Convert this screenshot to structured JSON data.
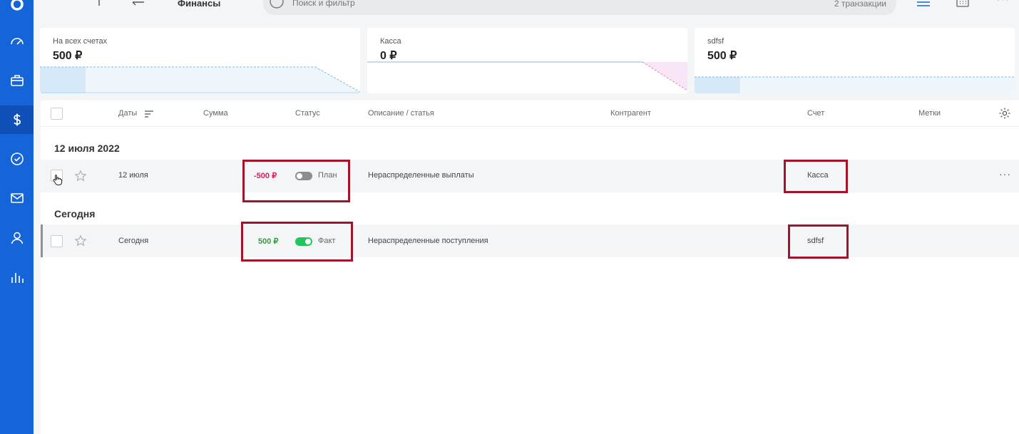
{
  "topbar": {
    "title": "Финансы",
    "search_placeholder": "Поиск и фильтр",
    "transaction_count": "2 транзакции"
  },
  "cards": [
    {
      "label": "На всех счетах",
      "value": "500 ₽"
    },
    {
      "label": "Касса",
      "value": "0 ₽"
    },
    {
      "label": "sdfsf",
      "value": "500 ₽"
    }
  ],
  "table": {
    "headers": {
      "dates": "Даты",
      "amount": "Сумма",
      "status": "Статус",
      "description": "Описание / статья",
      "counterparty": "Контрагент",
      "account": "Счет",
      "tags": "Метки"
    },
    "groups": [
      {
        "title": "12 июля 2022",
        "rows": [
          {
            "date": "12 июля",
            "amount": "-500 ₽",
            "status": "План",
            "status_on": false,
            "description": "Нераспределенные выплаты",
            "account": "Касса"
          }
        ]
      },
      {
        "title": "Сегодня",
        "rows": [
          {
            "date": "Сегодня",
            "amount": "500 ₽",
            "status": "Факт",
            "status_on": true,
            "description": "Нераспределенные поступления",
            "account": "sdfsf"
          }
        ]
      }
    ]
  },
  "colors": {
    "sidebar": "#1565d8",
    "negative": "#d81b60",
    "positive": "#2e9e3a",
    "toggle_on": "#22c55e",
    "toggle_off": "#8a8d91",
    "highlight": "#a3142a"
  }
}
